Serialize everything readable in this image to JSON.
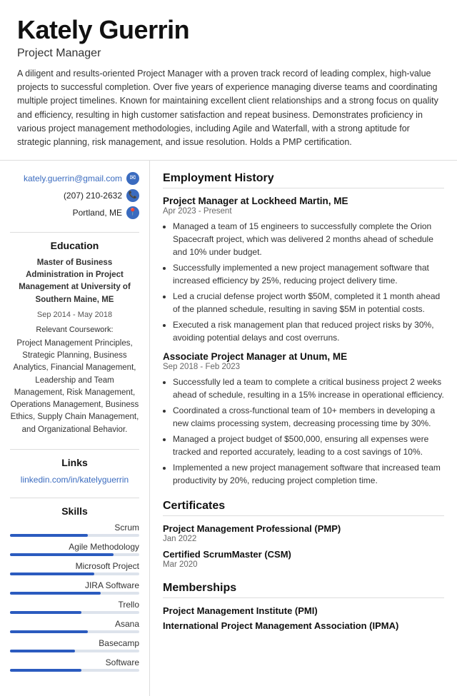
{
  "header": {
    "name": "Kately Guerrin",
    "title": "Project Manager",
    "summary": "A diligent and results-oriented Project Manager with a proven track record of leading complex, high-value projects to successful completion. Over five years of experience managing diverse teams and coordinating multiple project timelines. Known for maintaining excellent client relationships and a strong focus on quality and efficiency, resulting in high customer satisfaction and repeat business. Demonstrates proficiency in various project management methodologies, including Agile and Waterfall, with a strong aptitude for strategic planning, risk management, and issue resolution. Holds a PMP certification."
  },
  "contact": {
    "email": "kately.guerrin@gmail.com",
    "phone": "(207) 210-2632",
    "location": "Portland, ME"
  },
  "education": {
    "section_title": "Education",
    "degree": "Master of Business Administration in Project Management at University of Southern Maine, ME",
    "dates": "Sep 2014 - May 2018",
    "courses_label": "Relevant Coursework:",
    "courses": "Project Management Principles, Strategic Planning, Business Analytics, Financial Management, Leadership and Team Management, Risk Management, Operations Management, Business Ethics, Supply Chain Management, and Organizational Behavior."
  },
  "links": {
    "section_title": "Links",
    "linkedin": "linkedin.com/in/katelyguerrin"
  },
  "skills": {
    "section_title": "Skills",
    "items": [
      {
        "name": "Scrum",
        "pct": 60
      },
      {
        "name": "Agile Methodology",
        "pct": 80
      },
      {
        "name": "Microsoft Project",
        "pct": 65
      },
      {
        "name": "JIRA Software",
        "pct": 70
      },
      {
        "name": "Trello",
        "pct": 55
      },
      {
        "name": "Asana",
        "pct": 60
      },
      {
        "name": "Basecamp",
        "pct": 50
      },
      {
        "name": "Software",
        "pct": 55
      }
    ]
  },
  "employment": {
    "section_title": "Employment History",
    "jobs": [
      {
        "title": "Project Manager at Lockheed Martin, ME",
        "dates": "Apr 2023 - Present",
        "bullets": [
          "Managed a team of 15 engineers to successfully complete the Orion Spacecraft project, which was delivered 2 months ahead of schedule and 10% under budget.",
          "Successfully implemented a new project management software that increased efficiency by 25%, reducing project delivery time.",
          "Led a crucial defense project worth $50M, completed it 1 month ahead of the planned schedule, resulting in saving $5M in potential costs.",
          "Executed a risk management plan that reduced project risks by 30%, avoiding potential delays and cost overruns."
        ]
      },
      {
        "title": "Associate Project Manager at Unum, ME",
        "dates": "Sep 2018 - Feb 2023",
        "bullets": [
          "Successfully led a team to complete a critical business project 2 weeks ahead of schedule, resulting in a 15% increase in operational efficiency.",
          "Coordinated a cross-functional team of 10+ members in developing a new claims processing system, decreasing processing time by 30%.",
          "Managed a project budget of $500,000, ensuring all expenses were tracked and reported accurately, leading to a cost savings of 10%.",
          "Implemented a new project management software that increased team productivity by 20%, reducing project completion time."
        ]
      }
    ]
  },
  "certificates": {
    "section_title": "Certificates",
    "items": [
      {
        "name": "Project Management Professional (PMP)",
        "date": "Jan 2022"
      },
      {
        "name": "Certified ScrumMaster (CSM)",
        "date": "Mar 2020"
      }
    ]
  },
  "memberships": {
    "section_title": "Memberships",
    "items": [
      "Project Management Institute (PMI)",
      "International Project Management Association (IPMA)"
    ]
  }
}
